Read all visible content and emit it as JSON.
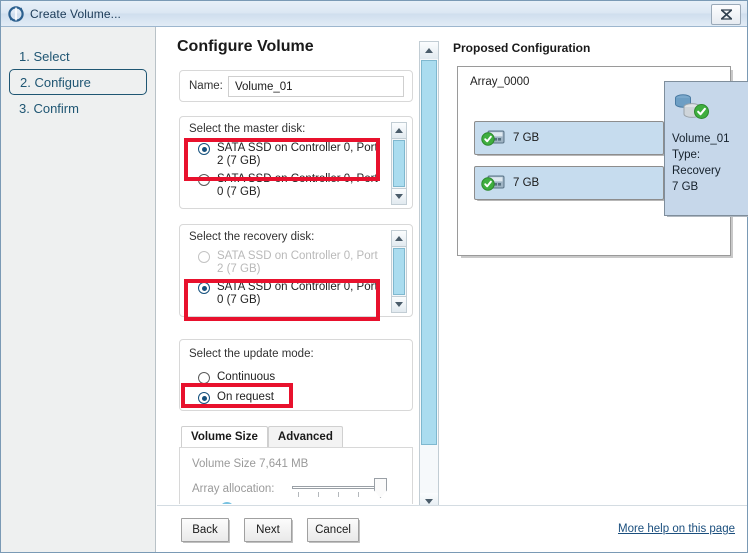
{
  "window": {
    "title": "Create Volume...",
    "icon": "app-refresh-icon",
    "close_label": "✕"
  },
  "sidebar": {
    "steps": [
      {
        "label": "1. Select",
        "active": false
      },
      {
        "label": "2. Configure",
        "active": true
      },
      {
        "label": "3. Confirm",
        "active": false
      }
    ]
  },
  "main": {
    "heading": "Configure Volume",
    "name_field": {
      "label": "Name:",
      "value": "Volume_01"
    },
    "master_disk": {
      "legend": "Select the master disk:",
      "options": [
        {
          "label": "SATA SSD on Controller 0, Port 2 (7 GB)",
          "selected": true,
          "disabled": false
        },
        {
          "label": "SATA SSD on Controller 0, Port 0 (7 GB)",
          "selected": false,
          "disabled": false
        }
      ]
    },
    "recovery_disk": {
      "legend": "Select the recovery disk:",
      "options": [
        {
          "label": "SATA SSD on Controller 0, Port 2 (7 GB)",
          "selected": false,
          "disabled": true
        },
        {
          "label": "SATA SSD on Controller 0, Port 0 (7 GB)",
          "selected": true,
          "disabled": false
        }
      ]
    },
    "update_mode": {
      "legend": "Select the update mode:",
      "options": [
        {
          "label": "Continuous",
          "selected": false
        },
        {
          "label": "On request",
          "selected": true
        }
      ]
    },
    "size_tabs": [
      {
        "label": "Volume Size",
        "selected": true
      },
      {
        "label": "Advanced",
        "selected": false
      }
    ],
    "volume_size": {
      "size_text": "Volume Size 7,641 MB",
      "allocation_label": "Array allocation:"
    }
  },
  "proposed": {
    "title": "Proposed Configuration",
    "array_name": "Array_0000",
    "disks": [
      {
        "capacity": "7 GB"
      },
      {
        "capacity": "7 GB"
      }
    ],
    "volume": {
      "name": "Volume_01",
      "type": "Type: Recovery",
      "capacity": "7 GB"
    }
  },
  "footer": {
    "back": "Back",
    "next": "Next",
    "cancel": "Cancel",
    "help": "More help on this page"
  },
  "colors": {
    "accent_blue": "#14507d",
    "highlight_red": "#e8112d",
    "scroll_thumb": "#aadcef",
    "volume_box": "#c6d7ea",
    "disk_bar": "#c6dcee"
  }
}
